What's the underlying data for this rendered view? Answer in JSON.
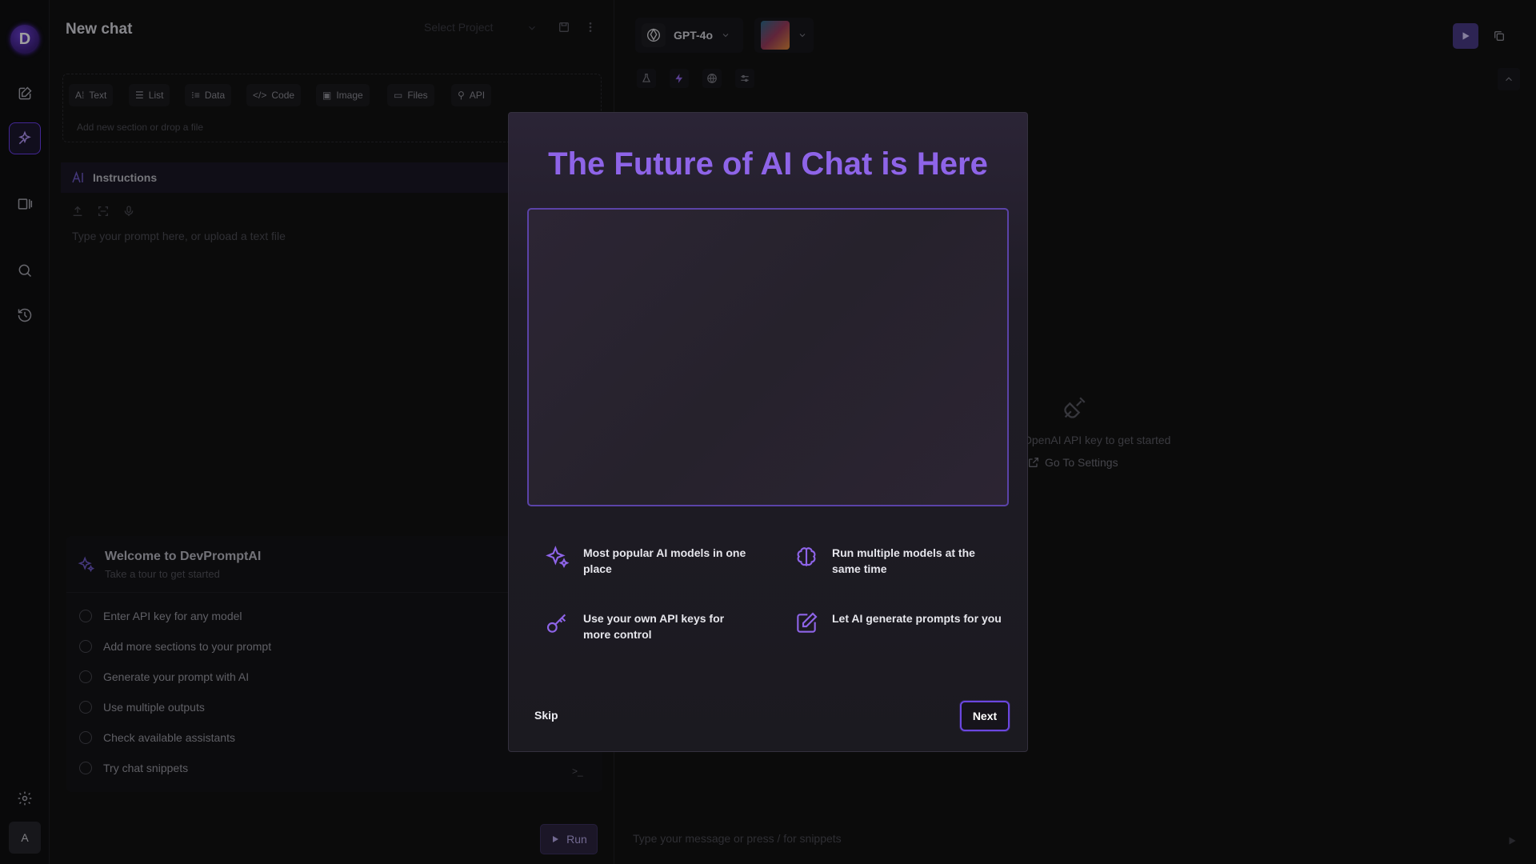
{
  "app": {
    "logo_letter": "D",
    "avatar_letter": "A"
  },
  "left_panel": {
    "title": "New chat",
    "select_project_placeholder": "Select Project",
    "toolbar": {
      "text": "Text",
      "list": "List",
      "data": "Data",
      "code": "Code",
      "image": "Image",
      "files": "Files",
      "api": "API",
      "hint": "Add new section or drop a file"
    },
    "instructions_label": "Instructions",
    "prompt_placeholder": "Type your prompt here, or upload a text file",
    "welcome": {
      "title": "Welcome to DevPromptAI",
      "subtitle": "Take a tour to get started",
      "items": [
        "Enter API key for any model",
        "Add more sections to your prompt",
        "Generate your prompt with AI",
        "Use multiple outputs",
        "Check available assistants",
        "Try chat snippets"
      ]
    },
    "run_label": "Run"
  },
  "right_panel": {
    "model_name": "GPT-4o",
    "api_message": "OpenAI API key to get started",
    "go_to_settings": "Go To Settings",
    "message_placeholder": "Type your message or press / for snippets"
  },
  "modal": {
    "title": "The Future of AI Chat is Here",
    "features": [
      "Most popular AI models in one place",
      "Run multiple models at the same time",
      "Use your own API keys for more control",
      "Let AI generate prompts for you"
    ],
    "skip_label": "Skip",
    "next_label": "Next"
  },
  "colors": {
    "accent": "#8e64e8",
    "accent_border": "#6b47e0",
    "background": "#121212"
  }
}
